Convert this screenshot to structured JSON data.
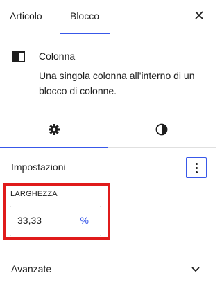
{
  "tabs": [
    "Articolo",
    "Blocco"
  ],
  "block": {
    "icon": "column-icon",
    "title": "Colonna",
    "description": "Una singola colonna all'interno di un blocco di colonne."
  },
  "inner_tabs": [
    {
      "icon": "gear-icon"
    },
    {
      "icon": "half-circle-icon"
    }
  ],
  "settings_panel": {
    "title": "Impostazioni",
    "width_label": "LARGHEZZA",
    "width_value": "33,33",
    "width_unit": "%"
  },
  "advanced_panel": {
    "title": "Avanzate"
  },
  "colors": {
    "accent": "#3858e9",
    "highlight": "#e01b1b"
  }
}
